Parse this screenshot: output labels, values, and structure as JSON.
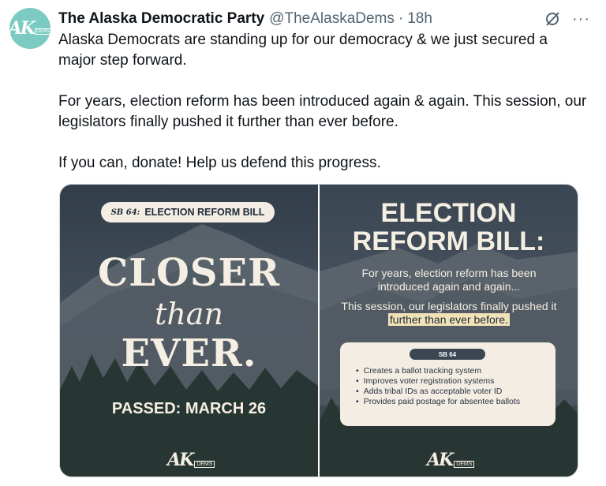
{
  "tweet": {
    "author_name": "The Alaska Democratic Party",
    "handle": "@TheAlaskaDems",
    "separator": "·",
    "time": "18h",
    "more_label": "···",
    "paragraphs": [
      "Alaska Democrats are standing up for our democracy & we just secured a major step forward.",
      "For years, election reform has been introduced again & again. This session, our legislators finally pushed it further than ever before.",
      "If you can, donate! Help us defend this progress."
    ]
  },
  "avatar": {
    "logo_text": "AK",
    "logo_sub": "DEMS",
    "color": "#7ccbc3"
  },
  "image_left": {
    "tag_prefix": "SB 64:",
    "tag_text": "ELECTION REFORM BILL",
    "line1": "CLOSER",
    "line2": "than",
    "line3": "EVER.",
    "passed": "PASSED: MARCH 26",
    "logo_text": "AK",
    "logo_sub": "DEMS"
  },
  "image_right": {
    "title_line1": "ELECTION",
    "title_line2": "REFORM BILL:",
    "intro": "For years, election reform has been introduced again and again...",
    "session_before": "This session, our legislators finally pushed it ",
    "session_highlight": "further than ever before.",
    "card_badge": "SB 64",
    "bullets": [
      "Creates a ballot tracking system",
      "Improves voter registration systems",
      "Adds tribal IDs as acceptable voter ID",
      "Provides paid postage for absentee ballots"
    ],
    "logo_text": "AK",
    "logo_sub": "DEMS"
  },
  "colors": {
    "accent_teal": "#7ccbc3",
    "cream": "#f5efe3",
    "highlight": "#f2e2b8",
    "handle_gray": "#536471"
  }
}
